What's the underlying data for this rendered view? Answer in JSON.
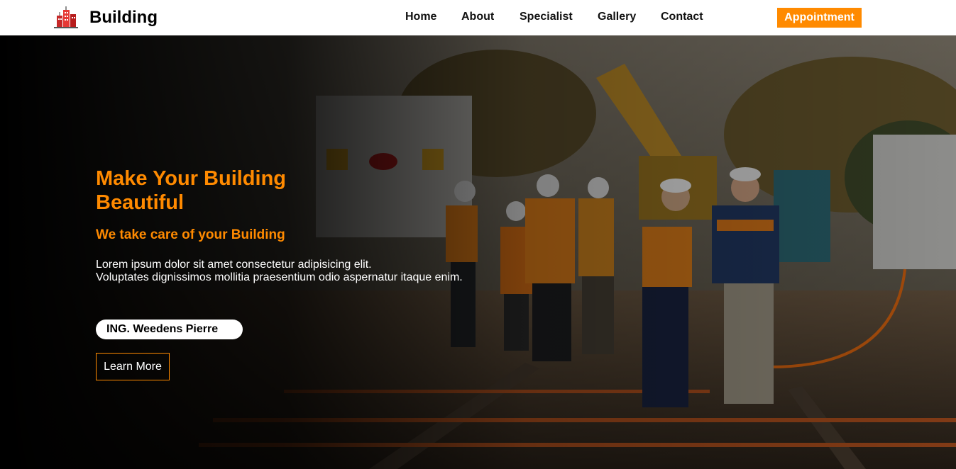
{
  "brand": {
    "name": "Building",
    "logo_icon": "building-logo-icon"
  },
  "nav": {
    "items": [
      {
        "label": "Home"
      },
      {
        "label": "About"
      },
      {
        "label": "Specialist"
      },
      {
        "label": "Gallery"
      },
      {
        "label": "Contact"
      }
    ],
    "cta_label": "Appointment"
  },
  "hero": {
    "title": "Make Your Building Beautiful",
    "subtitle": "We take care of your Building",
    "description_line1": "Lorem ipsum dolor sit amet consectetur adipisicing elit.",
    "description_line2": "Voluptates dignissimos mollitia praesentium odio aspernatur itaque enim.",
    "engineer": "ING. Weedens Pierre",
    "button_label": "Learn More",
    "background": "construction-site-image"
  },
  "colors": {
    "accent": "#ff8a00",
    "navbar_bg": "#ffffff",
    "text_light": "#ffffff"
  }
}
